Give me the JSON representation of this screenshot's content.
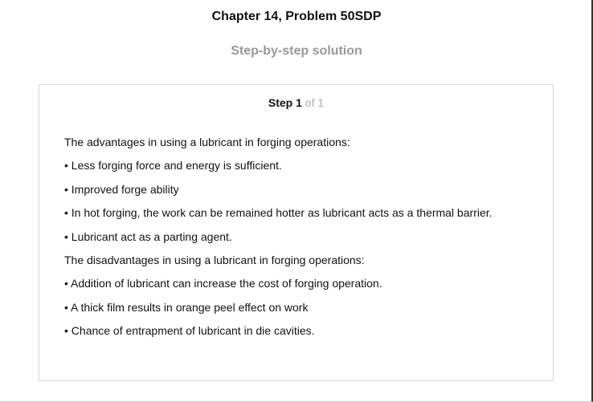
{
  "header": {
    "title": "Chapter 14, Problem 50SDP",
    "subtitle": "Step-by-step solution"
  },
  "step": {
    "word": "Step",
    "number": "1",
    "of_text": "of 1",
    "lines": [
      "The advantages in using a lubricant in forging operations:",
      "• Less forging force and energy is sufficient.",
      "• Improved forge ability",
      "• In hot forging, the work can be remained hotter as lubricant acts as a thermal barrier.",
      "• Lubricant act as a parting agent.",
      "The disadvantages in using a lubricant in forging operations:",
      "• Addition of lubricant can increase the cost of forging operation.",
      "• A thick film results in orange peel effect on work",
      "• Chance of entrapment of lubricant in die cavities."
    ]
  }
}
